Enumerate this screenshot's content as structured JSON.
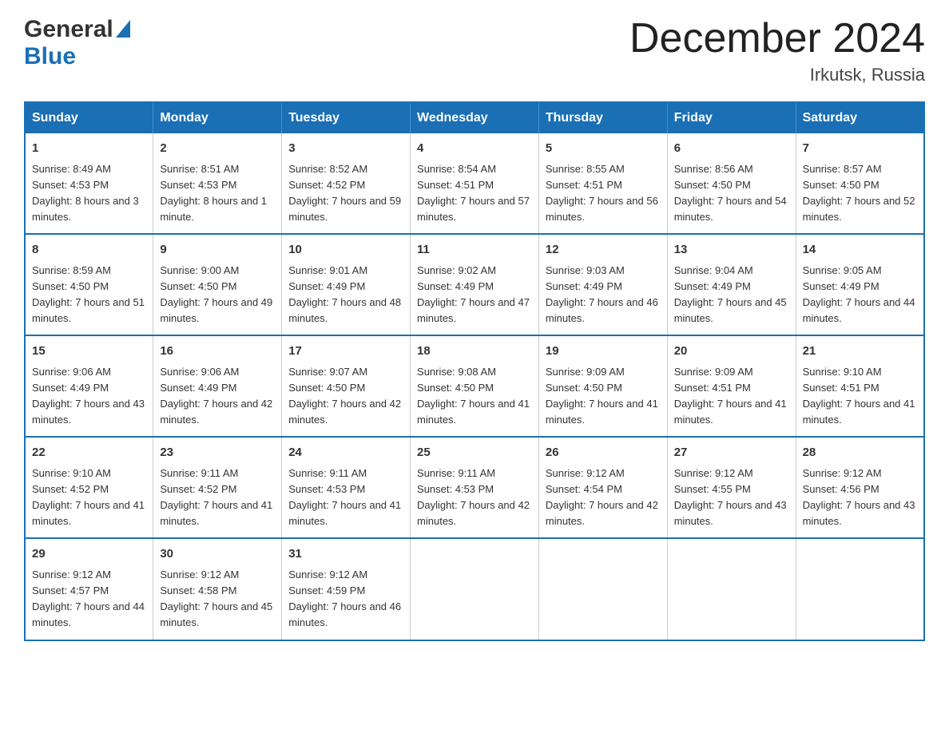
{
  "header": {
    "logo_general": "General",
    "logo_blue": "Blue",
    "month_title": "December 2024",
    "location": "Irkutsk, Russia"
  },
  "calendar": {
    "headers": [
      "Sunday",
      "Monday",
      "Tuesday",
      "Wednesday",
      "Thursday",
      "Friday",
      "Saturday"
    ],
    "weeks": [
      [
        {
          "day": "1",
          "sunrise": "Sunrise: 8:49 AM",
          "sunset": "Sunset: 4:53 PM",
          "daylight": "Daylight: 8 hours and 3 minutes."
        },
        {
          "day": "2",
          "sunrise": "Sunrise: 8:51 AM",
          "sunset": "Sunset: 4:53 PM",
          "daylight": "Daylight: 8 hours and 1 minute."
        },
        {
          "day": "3",
          "sunrise": "Sunrise: 8:52 AM",
          "sunset": "Sunset: 4:52 PM",
          "daylight": "Daylight: 7 hours and 59 minutes."
        },
        {
          "day": "4",
          "sunrise": "Sunrise: 8:54 AM",
          "sunset": "Sunset: 4:51 PM",
          "daylight": "Daylight: 7 hours and 57 minutes."
        },
        {
          "day": "5",
          "sunrise": "Sunrise: 8:55 AM",
          "sunset": "Sunset: 4:51 PM",
          "daylight": "Daylight: 7 hours and 56 minutes."
        },
        {
          "day": "6",
          "sunrise": "Sunrise: 8:56 AM",
          "sunset": "Sunset: 4:50 PM",
          "daylight": "Daylight: 7 hours and 54 minutes."
        },
        {
          "day": "7",
          "sunrise": "Sunrise: 8:57 AM",
          "sunset": "Sunset: 4:50 PM",
          "daylight": "Daylight: 7 hours and 52 minutes."
        }
      ],
      [
        {
          "day": "8",
          "sunrise": "Sunrise: 8:59 AM",
          "sunset": "Sunset: 4:50 PM",
          "daylight": "Daylight: 7 hours and 51 minutes."
        },
        {
          "day": "9",
          "sunrise": "Sunrise: 9:00 AM",
          "sunset": "Sunset: 4:50 PM",
          "daylight": "Daylight: 7 hours and 49 minutes."
        },
        {
          "day": "10",
          "sunrise": "Sunrise: 9:01 AM",
          "sunset": "Sunset: 4:49 PM",
          "daylight": "Daylight: 7 hours and 48 minutes."
        },
        {
          "day": "11",
          "sunrise": "Sunrise: 9:02 AM",
          "sunset": "Sunset: 4:49 PM",
          "daylight": "Daylight: 7 hours and 47 minutes."
        },
        {
          "day": "12",
          "sunrise": "Sunrise: 9:03 AM",
          "sunset": "Sunset: 4:49 PM",
          "daylight": "Daylight: 7 hours and 46 minutes."
        },
        {
          "day": "13",
          "sunrise": "Sunrise: 9:04 AM",
          "sunset": "Sunset: 4:49 PM",
          "daylight": "Daylight: 7 hours and 45 minutes."
        },
        {
          "day": "14",
          "sunrise": "Sunrise: 9:05 AM",
          "sunset": "Sunset: 4:49 PM",
          "daylight": "Daylight: 7 hours and 44 minutes."
        }
      ],
      [
        {
          "day": "15",
          "sunrise": "Sunrise: 9:06 AM",
          "sunset": "Sunset: 4:49 PM",
          "daylight": "Daylight: 7 hours and 43 minutes."
        },
        {
          "day": "16",
          "sunrise": "Sunrise: 9:06 AM",
          "sunset": "Sunset: 4:49 PM",
          "daylight": "Daylight: 7 hours and 42 minutes."
        },
        {
          "day": "17",
          "sunrise": "Sunrise: 9:07 AM",
          "sunset": "Sunset: 4:50 PM",
          "daylight": "Daylight: 7 hours and 42 minutes."
        },
        {
          "day": "18",
          "sunrise": "Sunrise: 9:08 AM",
          "sunset": "Sunset: 4:50 PM",
          "daylight": "Daylight: 7 hours and 41 minutes."
        },
        {
          "day": "19",
          "sunrise": "Sunrise: 9:09 AM",
          "sunset": "Sunset: 4:50 PM",
          "daylight": "Daylight: 7 hours and 41 minutes."
        },
        {
          "day": "20",
          "sunrise": "Sunrise: 9:09 AM",
          "sunset": "Sunset: 4:51 PM",
          "daylight": "Daylight: 7 hours and 41 minutes."
        },
        {
          "day": "21",
          "sunrise": "Sunrise: 9:10 AM",
          "sunset": "Sunset: 4:51 PM",
          "daylight": "Daylight: 7 hours and 41 minutes."
        }
      ],
      [
        {
          "day": "22",
          "sunrise": "Sunrise: 9:10 AM",
          "sunset": "Sunset: 4:52 PM",
          "daylight": "Daylight: 7 hours and 41 minutes."
        },
        {
          "day": "23",
          "sunrise": "Sunrise: 9:11 AM",
          "sunset": "Sunset: 4:52 PM",
          "daylight": "Daylight: 7 hours and 41 minutes."
        },
        {
          "day": "24",
          "sunrise": "Sunrise: 9:11 AM",
          "sunset": "Sunset: 4:53 PM",
          "daylight": "Daylight: 7 hours and 41 minutes."
        },
        {
          "day": "25",
          "sunrise": "Sunrise: 9:11 AM",
          "sunset": "Sunset: 4:53 PM",
          "daylight": "Daylight: 7 hours and 42 minutes."
        },
        {
          "day": "26",
          "sunrise": "Sunrise: 9:12 AM",
          "sunset": "Sunset: 4:54 PM",
          "daylight": "Daylight: 7 hours and 42 minutes."
        },
        {
          "day": "27",
          "sunrise": "Sunrise: 9:12 AM",
          "sunset": "Sunset: 4:55 PM",
          "daylight": "Daylight: 7 hours and 43 minutes."
        },
        {
          "day": "28",
          "sunrise": "Sunrise: 9:12 AM",
          "sunset": "Sunset: 4:56 PM",
          "daylight": "Daylight: 7 hours and 43 minutes."
        }
      ],
      [
        {
          "day": "29",
          "sunrise": "Sunrise: 9:12 AM",
          "sunset": "Sunset: 4:57 PM",
          "daylight": "Daylight: 7 hours and 44 minutes."
        },
        {
          "day": "30",
          "sunrise": "Sunrise: 9:12 AM",
          "sunset": "Sunset: 4:58 PM",
          "daylight": "Daylight: 7 hours and 45 minutes."
        },
        {
          "day": "31",
          "sunrise": "Sunrise: 9:12 AM",
          "sunset": "Sunset: 4:59 PM",
          "daylight": "Daylight: 7 hours and 46 minutes."
        },
        {
          "day": "",
          "sunrise": "",
          "sunset": "",
          "daylight": ""
        },
        {
          "day": "",
          "sunrise": "",
          "sunset": "",
          "daylight": ""
        },
        {
          "day": "",
          "sunrise": "",
          "sunset": "",
          "daylight": ""
        },
        {
          "day": "",
          "sunrise": "",
          "sunset": "",
          "daylight": ""
        }
      ]
    ]
  }
}
